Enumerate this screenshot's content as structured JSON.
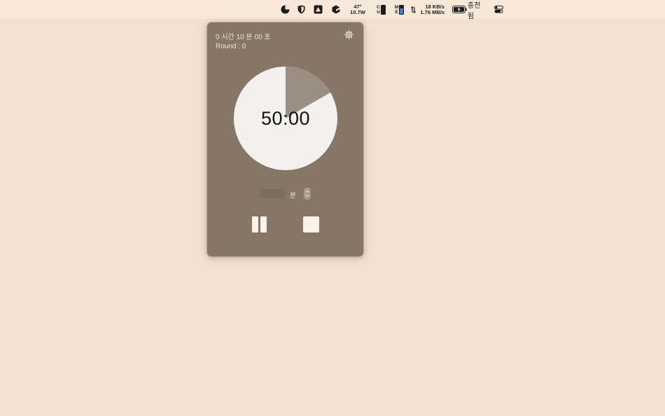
{
  "menubar": {
    "temp": "47°",
    "power": "10.7W",
    "cpu_label_top": "C",
    "cpu_label_bottom": "U",
    "mem_label_top": "M",
    "mem_label_bottom": "E",
    "net_up": "18 KB/s",
    "net_down": "1.76 MB/s",
    "battery_status": "충전됨",
    "icons": [
      "pie-menu-icon",
      "shield-icon",
      "drive-icon",
      "package-icon",
      "cpu-gauge-icon",
      "memory-gauge-icon",
      "network-arrows-icon",
      "battery-icon",
      "control-center-icon"
    ]
  },
  "timer": {
    "elapsed": "0 시간 10 분 00 초",
    "round": "Round : 0",
    "time_display": "50:00",
    "progress_elapsed_fraction": 0.1667,
    "minutes_placeholder": "60",
    "minutes_unit": "분",
    "colors": {
      "panel": "#857665",
      "dial": "#f3f1ef",
      "elapsed_slice": "#9b8e82",
      "buttons": "#fbf3ea"
    }
  }
}
